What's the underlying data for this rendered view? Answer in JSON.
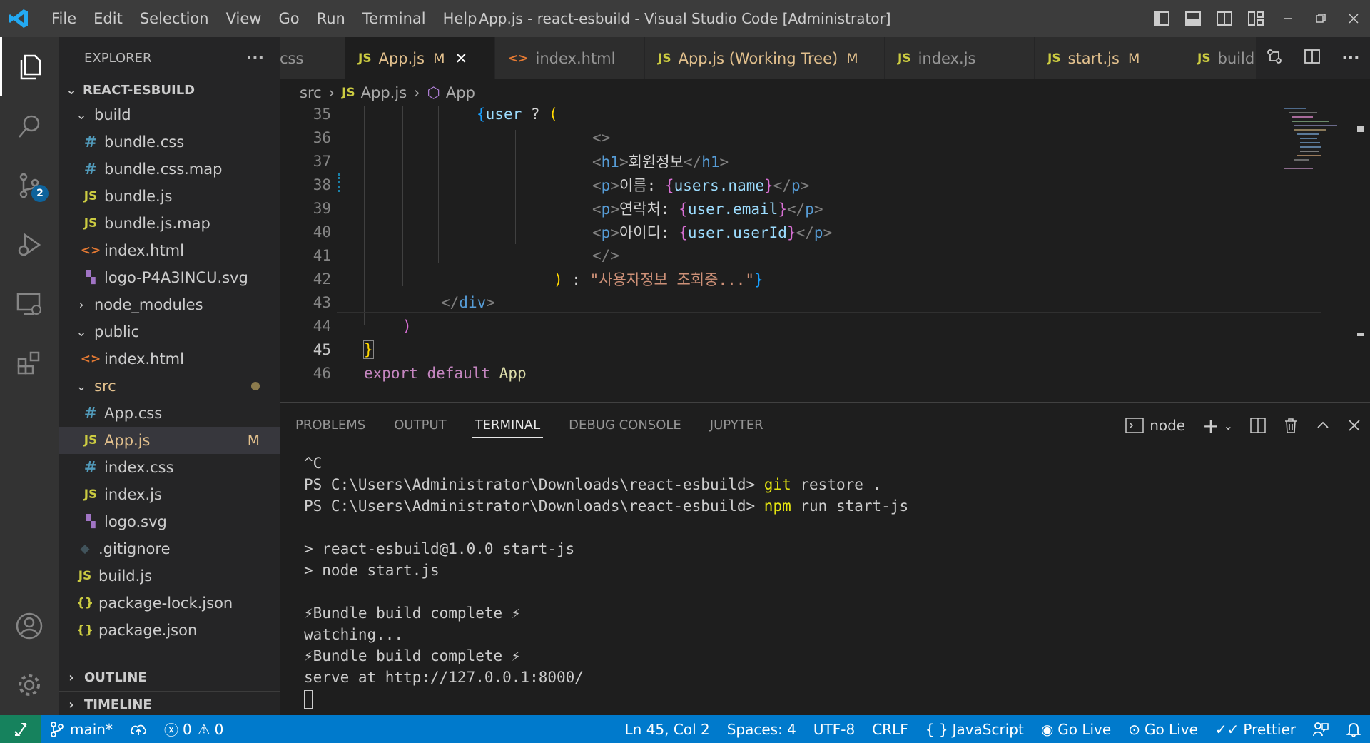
{
  "titlebar": {
    "menu": [
      "File",
      "Edit",
      "Selection",
      "View",
      "Go",
      "Run",
      "Terminal",
      "Help"
    ],
    "title": "App.js - react-esbuild - Visual Studio Code [Administrator]"
  },
  "activity": {
    "scm_badge": "2"
  },
  "sidebar": {
    "header": "EXPLORER",
    "header_more": "···",
    "root": "REACT-ESBUILD",
    "items": [
      {
        "label": "build",
        "type": "folder"
      },
      {
        "label": "bundle.css",
        "icon": "#"
      },
      {
        "label": "bundle.css.map",
        "icon": "#"
      },
      {
        "label": "bundle.js",
        "icon": "JS"
      },
      {
        "label": "bundle.js.map",
        "icon": "JS"
      },
      {
        "label": "index.html",
        "icon": "<>"
      },
      {
        "label": "logo-P4A3INCU.svg",
        "icon": "svg"
      },
      {
        "label": "node_modules",
        "type": "folder"
      },
      {
        "label": "public",
        "type": "folder"
      },
      {
        "label": "index.html",
        "icon": "<>"
      },
      {
        "label": "src",
        "type": "folder"
      },
      {
        "label": "App.css",
        "icon": "#"
      },
      {
        "label": "App.js",
        "icon": "JS",
        "mark": "M"
      },
      {
        "label": "index.css",
        "icon": "#"
      },
      {
        "label": "index.js",
        "icon": "JS"
      },
      {
        "label": "logo.svg",
        "icon": "svg"
      },
      {
        "label": ".gitignore",
        "icon": "◆"
      },
      {
        "label": "build.js",
        "icon": "JS"
      },
      {
        "label": "package-lock.json",
        "icon": "{}"
      },
      {
        "label": "package.json",
        "icon": "{}"
      }
    ],
    "outline": "OUTLINE",
    "timeline": "TIMELINE"
  },
  "tabs": [
    {
      "label": "css",
      "icon": ""
    },
    {
      "label": "App.js",
      "icon": "JS",
      "mod": "M",
      "close": "✕"
    },
    {
      "label": "index.html",
      "icon": "<>"
    },
    {
      "label": "App.js (Working Tree)",
      "icon": "JS",
      "mod": "M"
    },
    {
      "label": "index.js",
      "icon": "JS"
    },
    {
      "label": "start.js",
      "icon": "JS",
      "mod": "M"
    },
    {
      "label": "build",
      "icon": "JS"
    }
  ],
  "breadcrumb": {
    "folder": "src",
    "file_icon": "JS",
    "file": "App.js",
    "symbol": "App"
  },
  "editor": {
    "line_numbers": [
      "35",
      "36",
      "37",
      "38",
      "39",
      "40",
      "41",
      "42",
      "43",
      "44",
      "45",
      "46"
    ],
    "l35": {
      "br": "{",
      "var": "user",
      "op": " ? ",
      "paren": "("
    },
    "l36": "<>",
    "l37": {
      "open": "<",
      "tag": "h1",
      "close": ">",
      "text": "회원정보",
      "end_open": "</",
      "end_tag": "h1",
      "end_close": ">"
    },
    "l38": {
      "text": "이름: ",
      "expr_open": "{",
      "expr": "users.name",
      "expr_close": "}"
    },
    "l39": {
      "text": "연락처: ",
      "expr_open": "{",
      "expr": "user.email",
      "expr_close": "}"
    },
    "l40": {
      "text": "아이디: ",
      "expr_open": "{",
      "expr": "user.userId",
      "expr_close": "}"
    },
    "l41": "</>",
    "l42": {
      "paren": ")",
      "op": " : ",
      "str": "\"사용자정보 조회중...\"",
      "br": "}"
    },
    "l43": {
      "open": "</",
      "tag": "div",
      "close": ">"
    },
    "l44": ")",
    "l45": "}",
    "l46": {
      "kw": "export default",
      "name": "App"
    }
  },
  "panel": {
    "tabs": [
      "PROBLEMS",
      "OUTPUT",
      "TERMINAL",
      "DEBUG CONSOLE",
      "JUPYTER"
    ],
    "shell": "node",
    "terminal": {
      "l1": "^C",
      "prompt": "PS C:\\Users\\Administrator\\Downloads\\react-esbuild> ",
      "cmd1": "git",
      "args1": " restore .",
      "cmd2": "npm",
      "args2": " run start-js",
      "l4": "> react-esbuild@1.0.0 start-js",
      "l5": "> node start.js",
      "l6": "⚡Bundle build complete ⚡",
      "l7": "watching...",
      "l8": "⚡Bundle build complete ⚡",
      "l9": "serve at http://127.0.0.1:8000/"
    }
  },
  "status": {
    "branch": "main*",
    "errors": "0",
    "warnings": "0",
    "position": "Ln 45, Col 2",
    "spaces": "Spaces: 4",
    "encoding": "UTF-8",
    "eol": "CRLF",
    "language": "JavaScript",
    "golive1": "Go Live",
    "golive2": "Go Live",
    "prettier": "Prettier"
  },
  "colors": {
    "accent": "#007acc",
    "modified": "#e2c08d",
    "remote": "#16825d"
  }
}
